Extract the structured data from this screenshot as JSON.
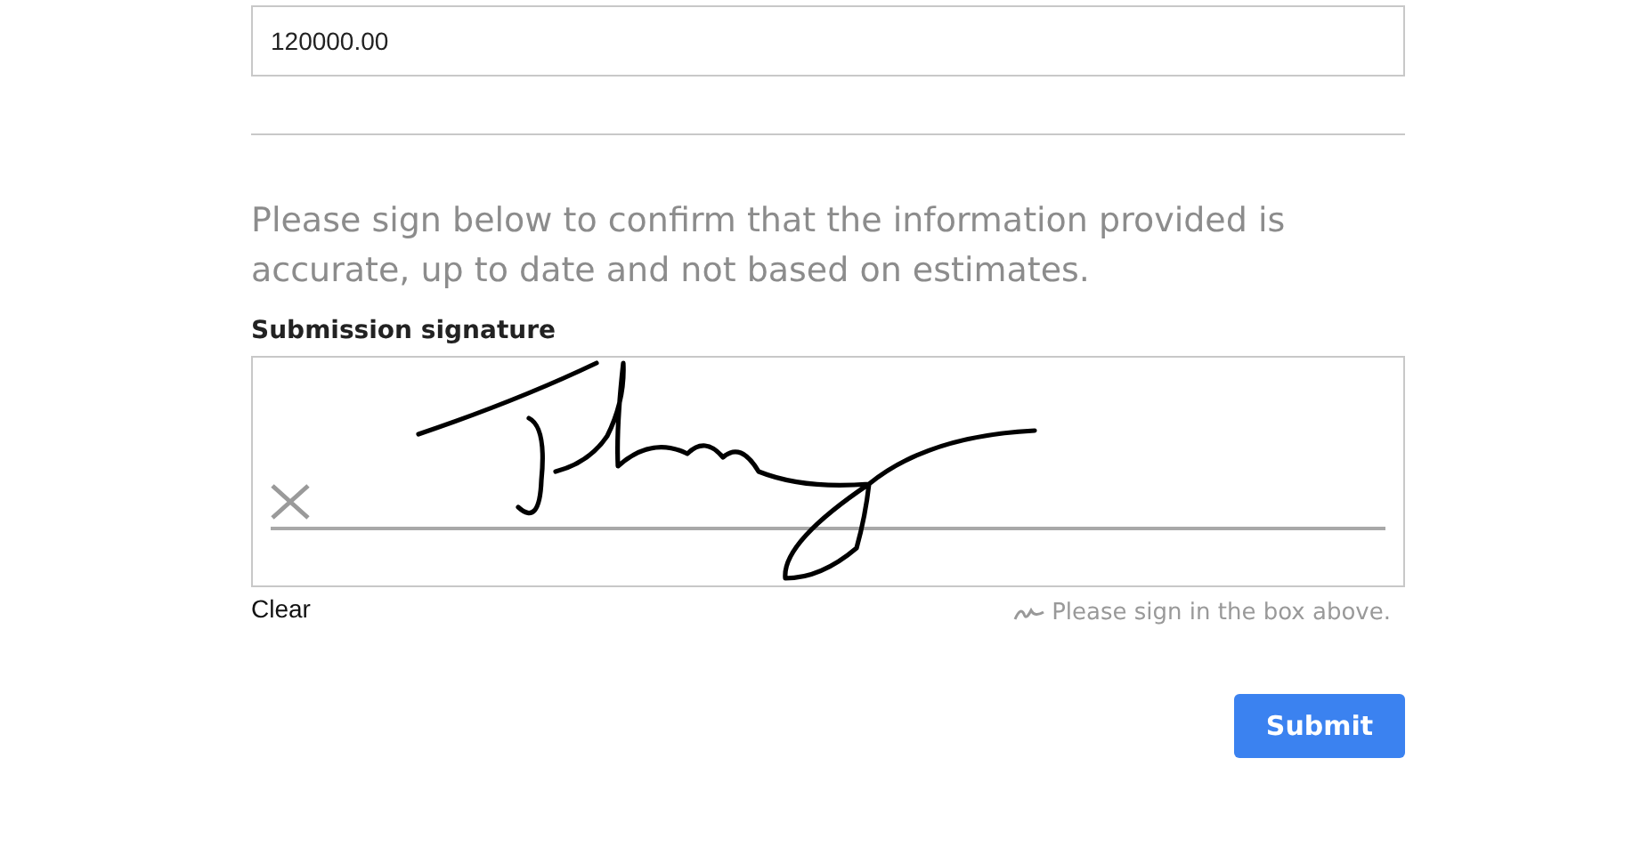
{
  "amount_field": {
    "value": "120000.00"
  },
  "instructions": "Please sign below to confirm that the information provided is accurate, up to date and not based on estimates.",
  "signature": {
    "label": "Submission signature",
    "signed": true,
    "clear_label": "Clear",
    "hint": "Please sign in the box above."
  },
  "buttons": [
    {
      "label": "Submit",
      "kind": "primary"
    }
  ]
}
